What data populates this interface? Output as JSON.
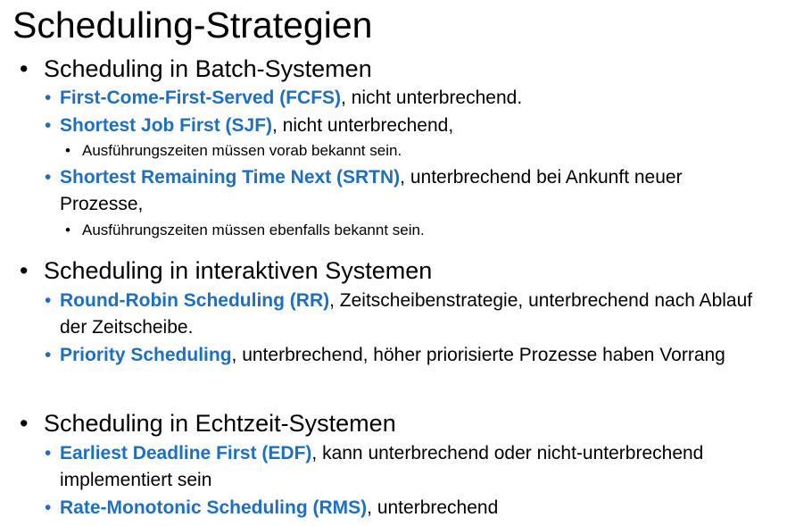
{
  "title": "Scheduling-Strategien",
  "sections": [
    {
      "heading": "Scheduling in Batch-Systemen",
      "items": [
        {
          "term": "First-Come-First-Served (FCFS)",
          "text": ", nicht unterbrechend."
        },
        {
          "term": "Shortest Job First (SJF)",
          "text": ", nicht unterbrechend,",
          "sub": "Ausführungszeiten müssen vorab bekannt sein."
        },
        {
          "term": "Shortest Remaining Time Next (SRTN)",
          "text": ", unterbrechend bei Ankunft neuer Prozesse,",
          "sub": "Ausführungszeiten müssen ebenfalls bekannt sein."
        }
      ]
    },
    {
      "heading": "Scheduling in interaktiven Systemen",
      "items": [
        {
          "term": "Round-Robin Scheduling (RR)",
          "text": ", Zeitscheibenstrategie, unterbrechend nach Ablauf der Zeitscheibe."
        },
        {
          "term": "Priority Scheduling",
          "text": ", unterbrechend, höher priorisierte Prozesse haben Vorrang"
        }
      ]
    },
    {
      "heading": "Scheduling in Echtzeit-Systemen",
      "items": [
        {
          "term": "Earliest Deadline First (EDF)",
          "text": ", kann unterbrechend oder nicht-unterbrechend implementiert sein"
        },
        {
          "term": "Rate-Monotonic Scheduling (RMS)",
          "text": ", unterbrechend"
        }
      ]
    }
  ],
  "colors": {
    "term": "#1f6fc0",
    "text": "#000000",
    "background": "#ffffff"
  }
}
